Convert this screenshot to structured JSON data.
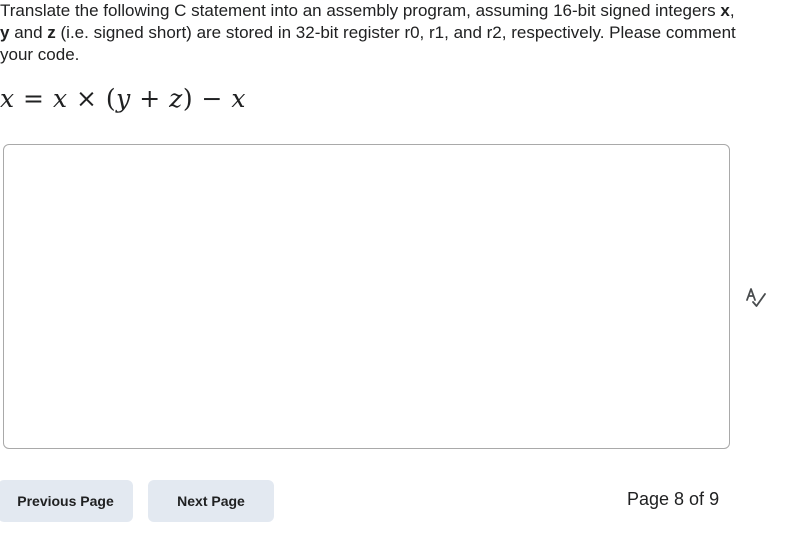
{
  "question": {
    "text_1": "Translate the following C statement into an assembly program, assuming 16-bit signed integers ",
    "var_x": "x",
    "sep_1": ", ",
    "var_y": "y",
    "sep_2": " and ",
    "var_z": "z",
    "text_2": " (i.e. signed short) are stored in 32-bit register r0, r1, and r2, respectively. Please comment your code."
  },
  "formula": {
    "lhs": "x",
    "eq": " = ",
    "t1": "x",
    "times": " × ",
    "lparen": "(",
    "t2": "y",
    "plus": " + ",
    "t3": "z",
    "rparen": ")",
    "minus": " − ",
    "t4": "x"
  },
  "answer": {
    "value": ""
  },
  "icons": {
    "spellcheck": "spellcheck-icon"
  },
  "navigation": {
    "previous_label": "Previous Page",
    "next_label": "Next Page",
    "page_indicator": "Page 8 of 9"
  }
}
